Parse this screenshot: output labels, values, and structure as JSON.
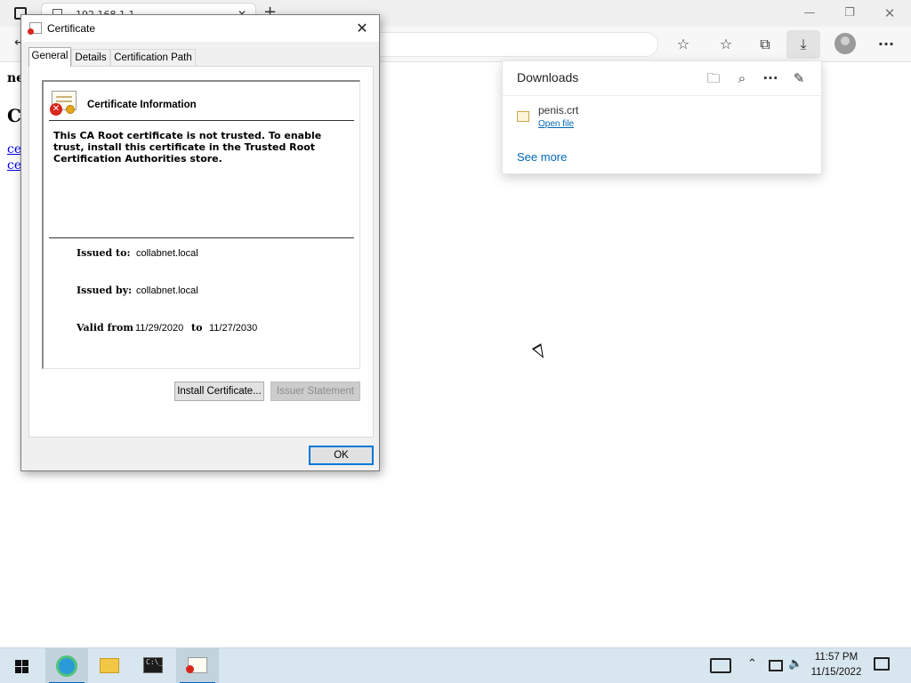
{
  "browser": {
    "tab_title": "192.168.1.1",
    "tab_close_glyph": "✕",
    "new_tab_glyph": "+",
    "window_controls": {
      "minimize": "—",
      "restore": "❐",
      "close": "✕"
    },
    "toolbar_icons": [
      "back-arrow-icon",
      "favorite-add-icon",
      "favorites-icon",
      "collections-icon",
      "download-icon",
      "profile-avatar",
      "more-icon"
    ]
  },
  "page": {
    "bold_text": "ne",
    "heading": "Ce",
    "links": [
      "ce",
      "ce"
    ]
  },
  "downloads": {
    "title": "Downloads",
    "items": [
      {
        "filename": "penis.crt",
        "action": "Open file"
      }
    ],
    "see_more": "See more"
  },
  "dialog": {
    "title": "Certificate",
    "tabs": [
      "General",
      "Details",
      "Certification Path"
    ],
    "active_tab": "General",
    "info_heading": "Certificate Information",
    "trust_warning": "This CA Root certificate is not trusted. To enable trust, install this certificate in the Trusted Root Certification Authorities store.",
    "issued_to_label": "Issued to:",
    "issued_to": "collabnet.local",
    "issued_by_label": "Issued by:",
    "issued_by": "collabnet.local",
    "valid_from_label": "Valid from",
    "valid_from": "11/29/2020",
    "valid_to_label": "to",
    "valid_to": "11/27/2030",
    "install_button": "Install Certificate...",
    "issuer_statement_button": "Issuer Statement",
    "ok_button": "OK"
  },
  "taskbar": {
    "apps": [
      "edge-icon",
      "file-explorer-icon",
      "terminal-icon",
      "certificate-icon"
    ],
    "terminal_glyph": "C:\\_",
    "time": "11:57 PM",
    "date": "11/15/2022"
  },
  "colors": {
    "link": "#0067b8",
    "accent": "#0078d7",
    "error": "#d9261c"
  }
}
